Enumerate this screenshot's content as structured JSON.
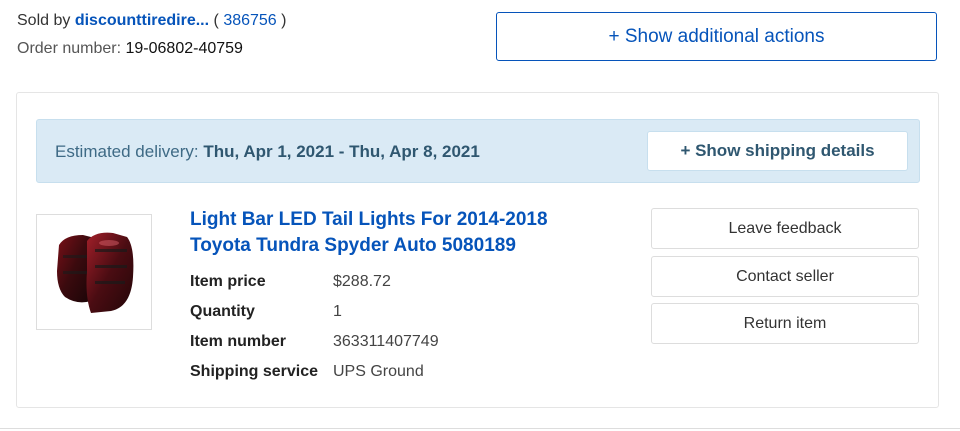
{
  "seller": {
    "prefix": "Sold by",
    "name": "discounttiredire...",
    "feedback_open": "(",
    "feedback_score": "386756",
    "feedback_close": ")"
  },
  "order": {
    "label": "Order number:",
    "number": "19-06802-40759"
  },
  "actions_button": "+ Show additional actions",
  "delivery": {
    "label": "Estimated delivery:",
    "dates": "Thu, Apr 1, 2021 - Thu, Apr 8, 2021",
    "shipping_details_button": "+ Show shipping details"
  },
  "item": {
    "title_line1": "Light Bar LED Tail Lights For 2014-2018",
    "title_line2": "Toyota Tundra Spyder Auto 5080189",
    "details": [
      {
        "label": "Item price",
        "value": "$288.72"
      },
      {
        "label": "Quantity",
        "value": "1"
      },
      {
        "label": "Item number",
        "value": "363311407749"
      },
      {
        "label": "Shipping service",
        "value": "UPS Ground"
      }
    ]
  },
  "item_actions": {
    "leave_feedback": "Leave feedback",
    "contact_seller": "Contact seller",
    "return_item": "Return item"
  },
  "colors": {
    "link_blue": "#0654ba",
    "delivery_bg": "#daeaf5",
    "delivery_text": "#2f5770"
  }
}
